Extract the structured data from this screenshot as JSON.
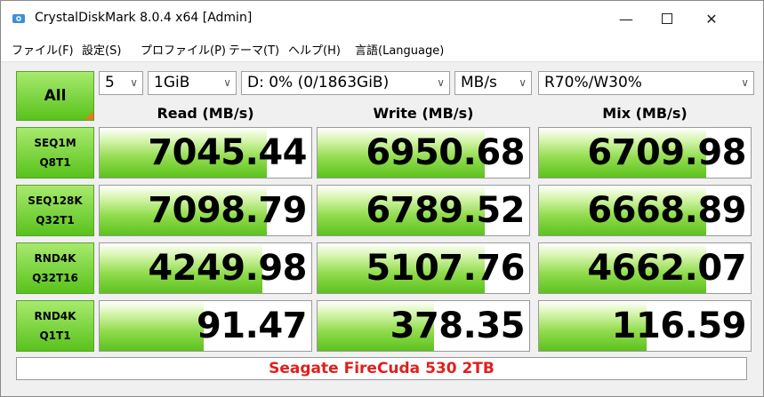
{
  "window": {
    "title": "CrystalDiskMark 8.0.4 x64 [Admin]"
  },
  "menu": [
    "ファイル(F)",
    "設定(S)",
    "プロファイル(P)",
    "テーマ(T)",
    "ヘルプ(H)",
    "言語(Language)"
  ],
  "controls": {
    "all_label": "All",
    "count": "5",
    "size": "1GiB",
    "drive": "D: 0% (0/1863GiB)",
    "unit": "MB/s",
    "mix": "R70%/W30%"
  },
  "headers": {
    "read": "Read (MB/s)",
    "write": "Write (MB/s)",
    "mix": "Mix (MB/s)"
  },
  "rows": [
    {
      "test_line1": "SEQ1M",
      "test_line2": "Q8T1",
      "read": "7045.44",
      "write": "6950.68",
      "mix": "6709.98",
      "fill": [
        0.79,
        0.79,
        0.79
      ]
    },
    {
      "test_line1": "SEQ128K",
      "test_line2": "Q32T1",
      "read": "7098.79",
      "write": "6789.52",
      "mix": "6668.89",
      "fill": [
        0.79,
        0.79,
        0.79
      ]
    },
    {
      "test_line1": "RND4K",
      "test_line2": "Q32T16",
      "read": "4249.98",
      "write": "5107.76",
      "mix": "4662.07",
      "fill": [
        0.77,
        0.79,
        0.79
      ]
    },
    {
      "test_line1": "RND4K",
      "test_line2": "Q1T1",
      "read": "91.47",
      "write": "378.35",
      "mix": "116.59",
      "fill": [
        0.49,
        0.55,
        0.51
      ]
    }
  ],
  "comment": "Seagate FireCuda 530 2TB",
  "icons": {
    "app": "crystaldiskmark-disk-icon",
    "minimize": "minimize-icon",
    "maximize": "maximize-icon",
    "close": "close-icon",
    "dropdown": "chevron-down-icon"
  },
  "colors": {
    "bar_green": "#5cc21d",
    "button_green": "#7fd93a",
    "comment_red": "#e0201c",
    "corner_orange": "#e87a18"
  }
}
